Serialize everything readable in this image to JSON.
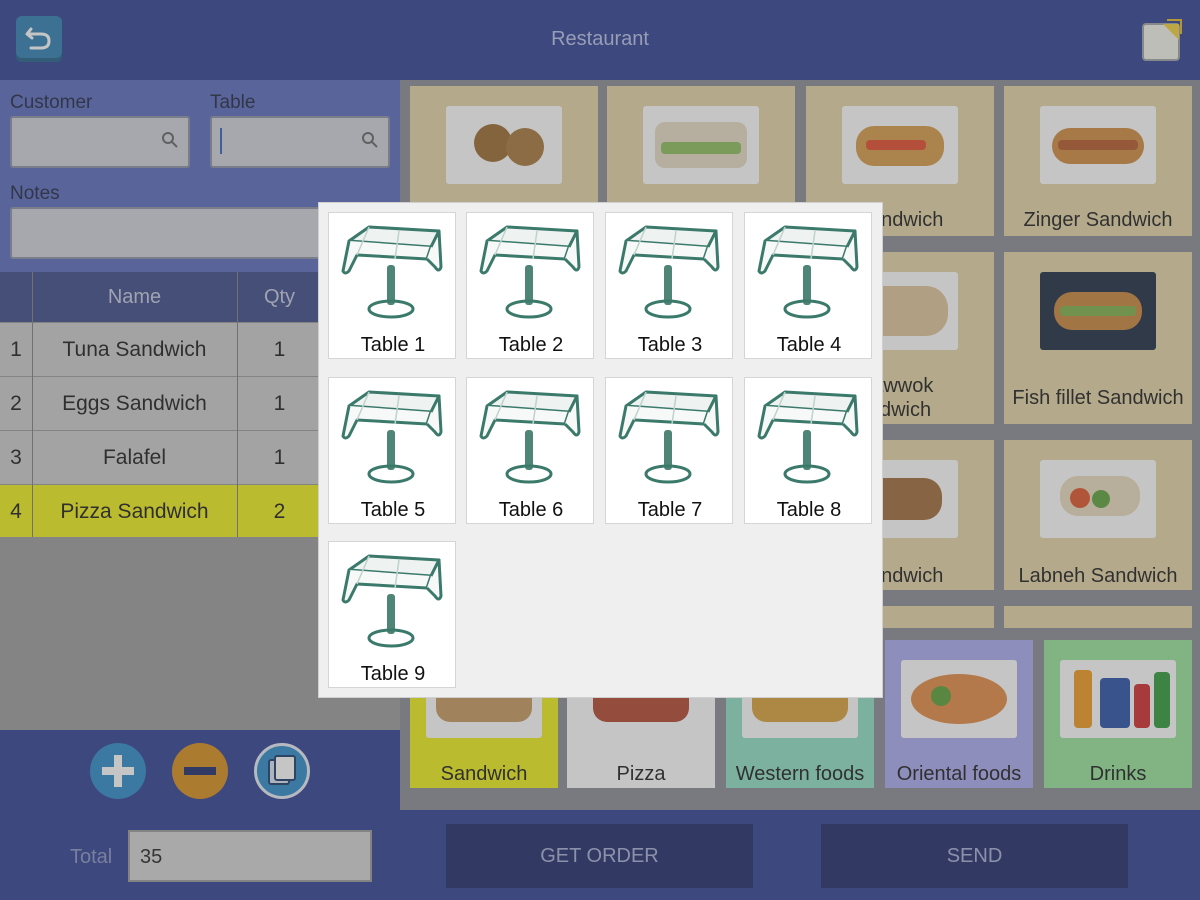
{
  "header": {
    "title": "Restaurant",
    "back_icon": "back-arrow-icon",
    "notes_icon": "notes-icon"
  },
  "order_form": {
    "customer_label": "Customer",
    "customer_value": "",
    "table_label": "Table",
    "table_value": "",
    "notes_label": "Notes",
    "notes_value": ""
  },
  "order_grid": {
    "columns": [
      "Name",
      "Qty"
    ],
    "rows": [
      {
        "num": "1",
        "name": "Tuna Sandwich",
        "qty": "1",
        "selected": false
      },
      {
        "num": "2",
        "name": "Eggs Sandwich",
        "qty": "1",
        "selected": false
      },
      {
        "num": "3",
        "name": "Falafel",
        "qty": "1",
        "selected": false
      },
      {
        "num": "4",
        "name": "Pizza Sandwich",
        "qty": "2",
        "selected": true
      }
    ]
  },
  "action_buttons": {
    "add_icon": "plus-icon",
    "remove_icon": "minus-icon",
    "copy_icon": "copy-icon"
  },
  "products": [
    {
      "label": ""
    },
    {
      "label": ""
    },
    {
      "label": "Sandwich"
    },
    {
      "label": "Zinger Sandwich"
    },
    {
      "label": "tawwok"
    },
    {
      "label": "ndwich"
    },
    {
      "label": "Fish fillet Sandwich"
    },
    {
      "label": "Sandwich"
    },
    {
      "label": "Labneh Sandwich"
    }
  ],
  "categories": [
    {
      "label": "Sandwich",
      "color": "#f0f01a"
    },
    {
      "label": "Pizza",
      "color": "#ffffff"
    },
    {
      "label": "Western foods",
      "color": "#8fe0c7"
    },
    {
      "label": "Oriental foods",
      "color": "#a9abf0"
    },
    {
      "label": "Drinks",
      "color": "#97e49a"
    }
  ],
  "footer": {
    "total_label": "Total",
    "total_value": "35",
    "get_order_label": "GET ORDER",
    "send_label": "SEND"
  },
  "table_dialog": {
    "tables": [
      {
        "label": "Table 1"
      },
      {
        "label": "Table 2"
      },
      {
        "label": "Table 3"
      },
      {
        "label": "Table 4"
      },
      {
        "label": "Table 5"
      },
      {
        "label": "Table 6"
      },
      {
        "label": "Table 7"
      },
      {
        "label": "Table 8"
      },
      {
        "label": "Table 9"
      }
    ]
  },
  "colors": {
    "header": "#2e3f92",
    "panel": "#5a6cbe",
    "selected_row": "#f0f01a",
    "product_card": "#e5d6a6"
  }
}
